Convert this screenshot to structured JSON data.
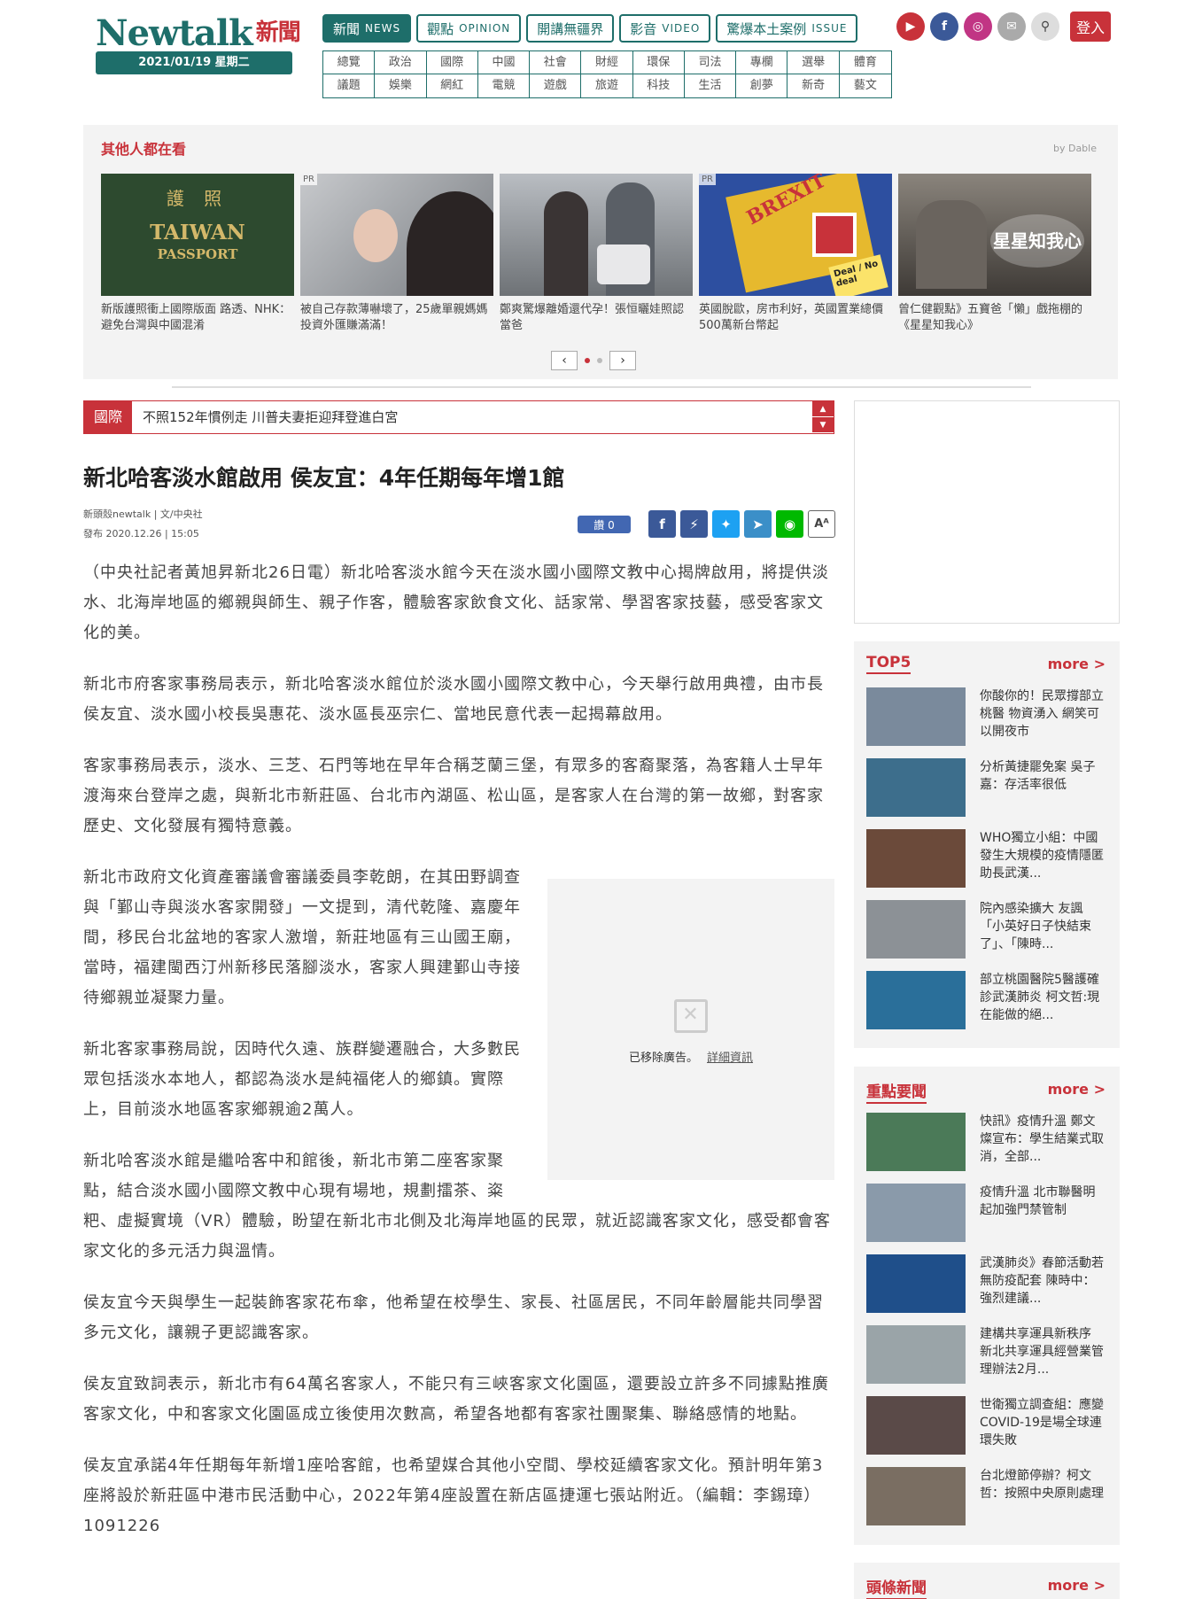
{
  "header": {
    "logo_text": "Newtalk",
    "logo_zh": "新聞",
    "date": "2021/01/19 星期二",
    "main_nav": [
      {
        "zh": "新聞",
        "en": "NEWS"
      },
      {
        "zh": "觀點",
        "en": "OPINION"
      },
      {
        "zh": "開講無疆界",
        "en": ""
      },
      {
        "zh": "影音",
        "en": "VIDEO"
      },
      {
        "zh": "驚爆本土案例",
        "en": "ISSUE"
      }
    ],
    "sub_nav": [
      "總覽",
      "政治",
      "國際",
      "中國",
      "社會",
      "財經",
      "環保",
      "司法",
      "專欄",
      "選舉",
      "體育",
      "議題",
      "娛樂",
      "網紅",
      "電競",
      "遊戲",
      "旅遊",
      "科技",
      "生活",
      "創夢",
      "新奇",
      "藝文"
    ],
    "social_icons": [
      "youtube-icon",
      "facebook-icon",
      "instagram-icon",
      "mail-icon",
      "search-icon"
    ],
    "login_label": "登入"
  },
  "recommend": {
    "title": "其他人都在看",
    "provider": "by Dable",
    "cards": [
      {
        "text": "新版護照衝上國際版面 路透、NHK：避免台灣與中國混淆",
        "pr": "",
        "thumb_color": "#2d4a2f"
      },
      {
        "text": "被自己存款薄嚇壞了，25歲單親媽媽投資外匯賺滿滿！",
        "pr": "PR",
        "thumb_color": "#9a9aa0"
      },
      {
        "text": "鄭爽驚爆離婚還代孕！張恒曬娃照認當爸",
        "pr": "",
        "thumb_color": "#8c8f94"
      },
      {
        "text": "英國脫歐，房市利好，英國置業總價500萬新台幣起",
        "pr": "PR",
        "thumb_color": "#2d4fa0"
      },
      {
        "text": "曾仁健觀點》五寶爸「懶」戲拖棚的《星星知我心》",
        "pr": "",
        "thumb_color": "#5a5550"
      }
    ],
    "passport_lines": [
      "護 照",
      "TAIWAN",
      "PASSPORT"
    ],
    "brexit_text": "BREXIT",
    "deal_text": "Deal / No deal",
    "show_title": "星星知我心"
  },
  "ticker": {
    "tag": "國際",
    "text": "不照152年慣例走 川普夫妻拒迎拜登進白宮"
  },
  "article": {
    "title": "新北哈客淡水館啟用 侯友宜：4年任期每年增1館",
    "source": "新頭殼newtalk | 文/中央社",
    "published": "發布 2020.12.26 | 15:05",
    "like_label": "讚 0",
    "share_icons": [
      "facebook-icon",
      "messenger-icon",
      "twitter-icon",
      "telegram-icon",
      "line-icon",
      "font-size-icon"
    ],
    "paragraphs": [
      "（中央社記者黃旭昇新北26日電）新北哈客淡水館今天在淡水國小國際文教中心揭牌啟用，將提供淡水、北海岸地區的鄉親與師生、親子作客，體驗客家飲食文化、話家常、學習客家技藝，感受客家文化的美。",
      "新北市府客家事務局表示，新北哈客淡水館位於淡水國小國際文教中心，今天舉行啟用典禮，由市長侯友宜、淡水國小校長吳惠花、淡水區長巫宗仁、當地民意代表一起揭幕啟用。",
      "客家事務局表示，淡水、三芝、石門等地在早年合稱芝蘭三堡，有眾多的客裔聚落，為客籍人士早年渡海來台登岸之處，與新北市新莊區、台北市內湖區、松山區，是客家人在台灣的第一故鄉，對客家歷史、文化發展有獨特意義。",
      "新北市政府文化資產審議會審議委員李乾朗，在其田野調查與「鄞山寺與淡水客家開發」一文提到，清代乾隆、嘉慶年間，移民台北盆地的客家人激增，新莊地區有三山國王廟，當時，福建閩西汀州新移民落腳淡水，客家人興建鄞山寺接待鄉親並凝聚力量。",
      "新北客家事務局說，因時代久遠、族群變遷融合，大多數民眾包括淡水本地人，都認為淡水是純福佬人的鄉鎮。實際上，目前淡水地區客家鄉親逾2萬人。",
      "新北哈客淡水館是繼哈客中和館後，新北市第二座客家聚點，結合淡水國小國際文教中心現有場地，規劃擂茶、粢粑、虛擬實境（VR）體驗，盼望在新北市北側及北海岸地區的民眾，就近認識客家文化，感受都會客家文化的多元活力與溫情。",
      "侯友宜今天與學生一起裝飾客家花布傘，他希望在校學生、家長、社區居民，不同年齡層能共同學習多元文化，讓親子更認識客家。",
      "侯友宜致詞表示，新北市有64萬名客家人，不能只有三峽客家文化園區，還要設立許多不同據點推廣客家文化，中和客家文化園區成立後使用次數高，希望各地都有客家社團聚集、聯絡感情的地點。",
      "侯友宜承諾4年任期每年新增1座哈客館，也希望媒合其他小空間、學校延續客家文化。預計明年第3座將設於新莊區中港市民活動中心，2022年第4座設置在新店區捷運七張站附近。（編輯：李錫璋）1091226"
    ],
    "ad_removed": "已移除廣告。",
    "ad_details": "詳細資訊"
  },
  "sidebar": {
    "top5": {
      "title": "TOP5",
      "more": "more >",
      "items": [
        {
          "text": "你酸你的！民眾撐部立桃醫 物資湧入 網笑可以開夜市",
          "thumb_color": "#7a8a9c"
        },
        {
          "text": "分析黃捷罷免案 吳子嘉：存活率很低",
          "thumb_color": "#3d6e8c"
        },
        {
          "text": "WHO獨立小組：中國發生大規模的疫情隱匿 助長武漢...",
          "thumb_color": "#6b4a3a"
        },
        {
          "text": "院內感染擴大 友諷「小英好日子快結束了」、「陳時...",
          "thumb_color": "#8c9196"
        },
        {
          "text": "部立桃園醫院5醫護確診武漢肺炎 柯文哲:現在能做的絕...",
          "thumb_color": "#2a6f9a"
        }
      ]
    },
    "key_news": {
      "title": "重點要聞",
      "more": "more >",
      "items": [
        {
          "text": "快訊》疫情升溫 鄭文燦宣布：學生結業式取消，全部...",
          "thumb_color": "#4b7a58"
        },
        {
          "text": "疫情升溫 北市聯醫明起加強門禁管制",
          "thumb_color": "#8a9aaa"
        },
        {
          "text": "武漢肺炎》春節活動若無防疫配套 陳時中：強烈建議...",
          "thumb_color": "#1f4f8a"
        },
        {
          "text": "建構共享運具新秩序 新北共享運具經營業管理辦法2月...",
          "thumb_color": "#9aa4a8"
        },
        {
          "text": "世衛獨立調查組：應變COVID-19是場全球連環失敗",
          "thumb_color": "#5a4a48"
        },
        {
          "text": "台北燈節停辦？柯文哲：按照中央原則處理",
          "thumb_color": "#7a6e62"
        }
      ]
    },
    "headline_news": {
      "title": "頭條新聞",
      "more": "more >"
    }
  }
}
